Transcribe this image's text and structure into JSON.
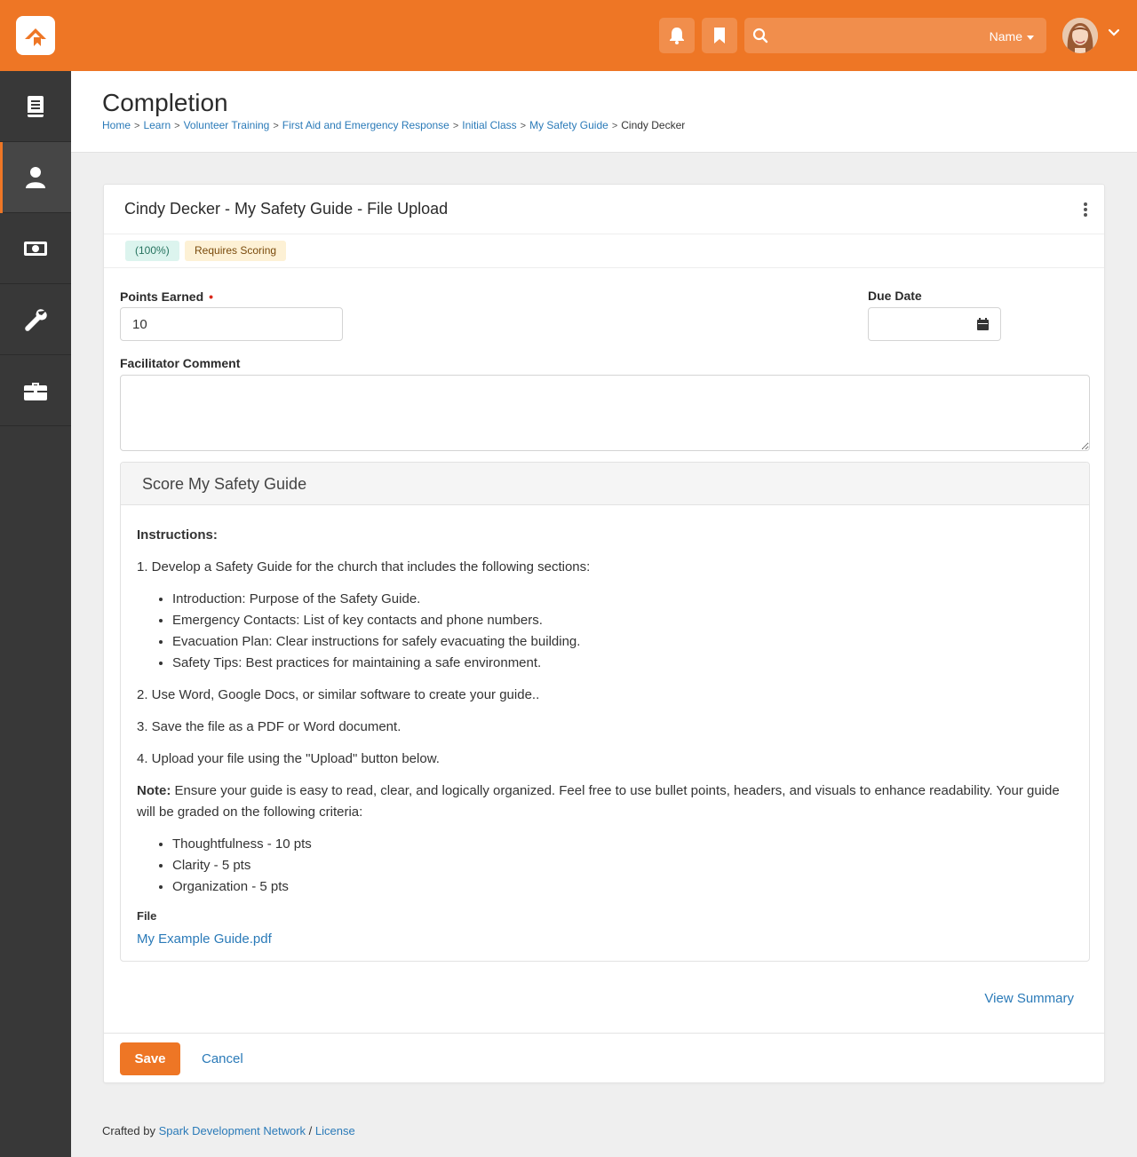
{
  "header": {
    "search_placeholder": "",
    "user_menu_label": "Name"
  },
  "page": {
    "title": "Completion",
    "breadcrumb": [
      {
        "label": "Home"
      },
      {
        "label": "Learn"
      },
      {
        "label": "Volunteer Training"
      },
      {
        "label": "First Aid and Emergency Response"
      },
      {
        "label": "Initial Class"
      },
      {
        "label": "My Safety Guide"
      }
    ],
    "breadcrumb_current": "Cindy Decker"
  },
  "card": {
    "title": "Cindy Decker - My Safety Guide - File Upload",
    "badges": {
      "percent": "(100%)",
      "requires_scoring": "Requires Scoring"
    },
    "points_earned": {
      "label": "Points Earned",
      "required_mark": "•",
      "value": "10"
    },
    "due_date": {
      "label": "Due Date",
      "value": ""
    },
    "facilitator_comment": {
      "label": "Facilitator Comment",
      "value": ""
    }
  },
  "score_panel": {
    "title": "Score My Safety Guide",
    "instructions_heading": "Instructions:",
    "step1": "1. Develop a Safety Guide for the church that includes the following sections:",
    "sections": [
      "Introduction: Purpose of the Safety Guide.",
      "Emergency Contacts: List of key contacts and phone numbers.",
      "Evacuation Plan: Clear instructions for safely evacuating the building.",
      "Safety Tips: Best practices for maintaining a safe environment."
    ],
    "step2": "2. Use Word, Google Docs, or similar software to create your guide..",
    "step3": "3. Save the file as a PDF or Word document.",
    "step4": "4. Upload your file using the \"Upload\" button below.",
    "note_label": "Note:",
    "note_text": " Ensure your guide is easy to read, clear, and logically organized. Feel free to use bullet points, headers, and visuals to enhance readability. Your guide will be graded on the following criteria:",
    "criteria": [
      "Thoughtfulness - 10 pts",
      "Clarity - 5 pts",
      "Organization - 5 pts"
    ],
    "file_label": "File",
    "file_name": "My Example Guide.pdf"
  },
  "actions": {
    "view_summary": "View Summary",
    "save": "Save",
    "cancel": "Cancel"
  },
  "footer": {
    "prefix": "Crafted by ",
    "org": "Spark Development Network",
    "divider": " / ",
    "license": "License"
  },
  "colors": {
    "brand": "#ee7625",
    "link": "#2a7ab8",
    "sidebar": "#383838"
  },
  "icons": {
    "logo": "rock-logo-icon",
    "notifications": "bell-icon",
    "bookmarks": "bookmark-icon",
    "search": "search-icon",
    "sidebar": [
      "book-icon",
      "person-icon",
      "money-icon",
      "wrench-icon",
      "briefcase-icon"
    ],
    "calendar": "calendar-icon",
    "menu": "kebab-menu-icon"
  }
}
